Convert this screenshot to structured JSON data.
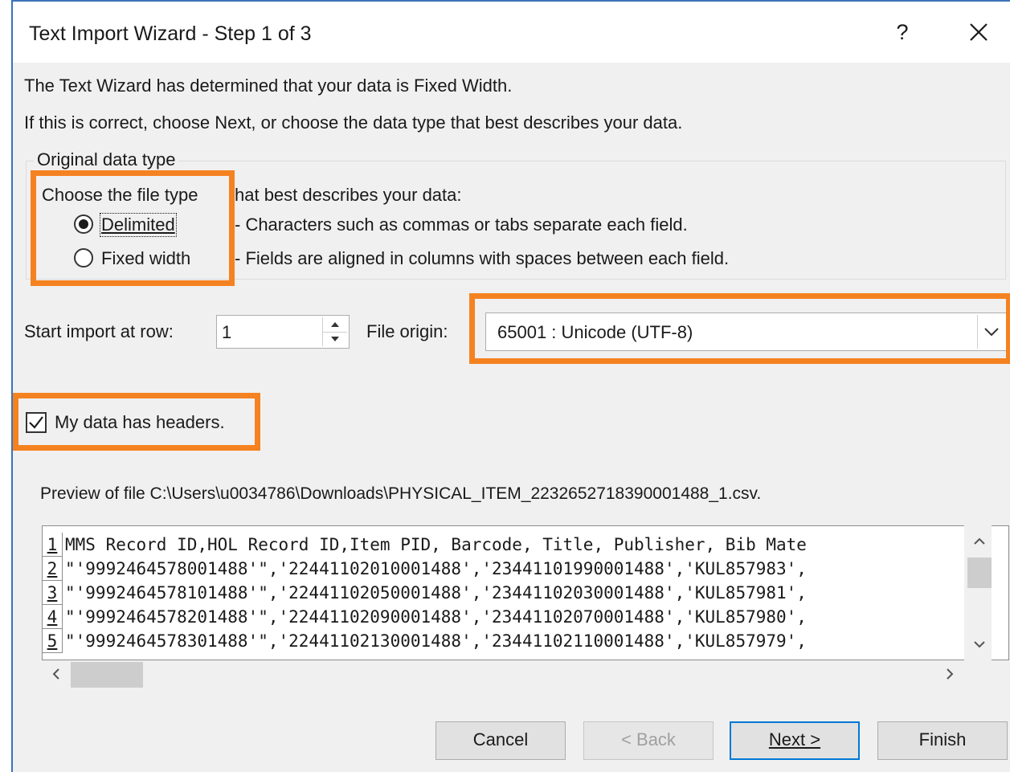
{
  "window": {
    "title": "Text Import Wizard - Step 1 of 3",
    "help_label": "?"
  },
  "intro": {
    "line1": "The Text Wizard has determined that your data is Fixed Width.",
    "line2": "If this is correct, choose Next, or choose the data type that best describes your data."
  },
  "original_data_type": {
    "legend": "Original data type",
    "prompt_part1": "Choose the file type",
    "prompt_part2": "hat best describes your data:",
    "options": [
      {
        "label": "Delimited",
        "description": "- Characters such as commas or tabs separate each field.",
        "selected": true
      },
      {
        "label": "Fixed width",
        "description": "- Fields are aligned in columns with spaces between each field.",
        "selected": false
      }
    ]
  },
  "start_row": {
    "label": "Start import at row:",
    "value": "1"
  },
  "file_origin": {
    "label": "File origin:",
    "value": "65001 : Unicode (UTF-8)"
  },
  "headers_checkbox": {
    "label": "My data has headers.",
    "checked": true
  },
  "preview": {
    "label": "Preview of file C:\\Users\\u0034786\\Downloads\\PHYSICAL_ITEM_2232652718390001488_1.csv.",
    "rows": [
      {
        "num": "1",
        "text": "MMS Record ID,HOL Record ID,Item PID, Barcode, Title, Publisher, Bib Mate"
      },
      {
        "num": "2",
        "text": "\"'9992464578001488'\",'22441102010001488','23441101990001488','KUL857983',"
      },
      {
        "num": "3",
        "text": "\"'9992464578101488'\",'22441102050001488','23441102030001488','KUL857981',"
      },
      {
        "num": "4",
        "text": "\"'9992464578201488'\",'22441102090001488','23441102070001488','KUL857980',"
      },
      {
        "num": "5",
        "text": "\"'9992464578301488'\",'22441102130001488','23441102110001488','KUL857979',"
      }
    ]
  },
  "buttons": {
    "cancel": "Cancel",
    "back": "< Back",
    "next": "Next >",
    "finish": "Finish"
  },
  "colors": {
    "highlight": "#f58220",
    "title_border": "#3b73b9",
    "default_button_border": "#0078d7"
  }
}
